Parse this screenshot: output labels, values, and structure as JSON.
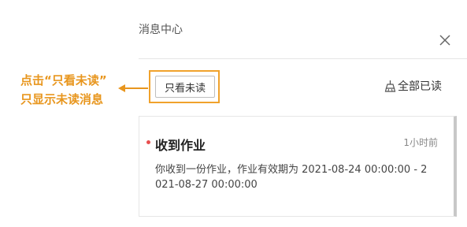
{
  "header": {
    "title": "消息中心",
    "close_icon": "close-icon"
  },
  "annotation": {
    "line1": "点击“只看未读”",
    "line2": "只显示未读消息",
    "color": "#e8961e"
  },
  "toolbar": {
    "unread_filter_label": "只看未读",
    "mark_all_read_label": "全部已读",
    "mark_all_read_icon": "broom-icon"
  },
  "messages": [
    {
      "title": "收到作业",
      "time": "1小时前",
      "body": "你收到一份作业，作业有效期为 2021-08-24 00:00:00 - 2021-08-27 00:00:00",
      "unread": true
    }
  ],
  "colors": {
    "highlight": "#f0a22c",
    "unread_dot": "#e84f4f"
  }
}
